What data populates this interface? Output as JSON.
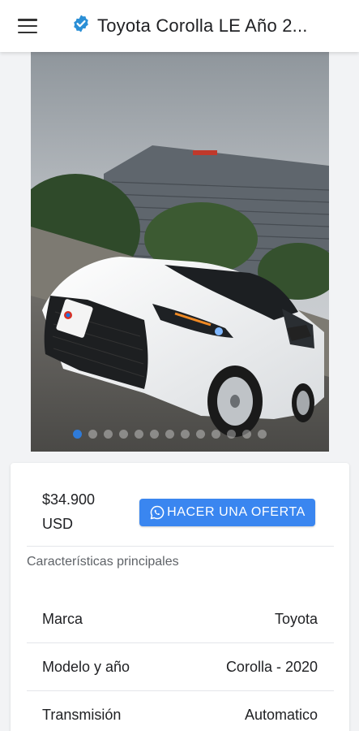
{
  "header": {
    "title": "Toyota Corolla LE Año 2...",
    "menu_icon": "hamburger-menu-icon",
    "badge_icon": "verified-badge-icon",
    "badge_color": "#2b8fd6"
  },
  "gallery": {
    "active_index": 0,
    "dot_count": 13,
    "plate_text": "·mos"
  },
  "listing": {
    "price_amount": "$34.900",
    "price_currency": "USD",
    "offer_button_label": "HACER UNA OFERTA",
    "offer_icon": "whatsapp-icon",
    "accent_color": "#3a86f0",
    "features_title": "Características principales",
    "features": [
      {
        "label": "Marca",
        "value": "Toyota"
      },
      {
        "label": "Modelo y año",
        "value": "Corolla - 2020"
      },
      {
        "label": "Transmisión",
        "value": "Automatico"
      }
    ]
  }
}
